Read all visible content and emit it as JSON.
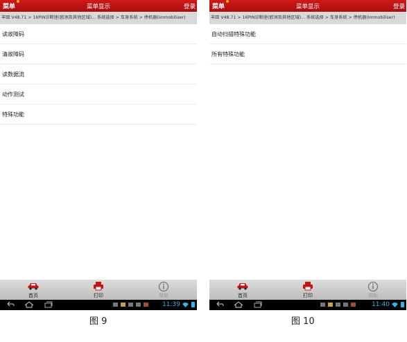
{
  "screens": [
    {
      "app_bar": {
        "menu": "菜单",
        "title": "菜单显示",
        "login": "登录"
      },
      "breadcrumb": "丰田 V48.71 > 16PIN诊断座(欧洲及其他区域)... 系统选择 > 车身系统 > 停机器(Immobiliser)",
      "items": [
        "读故障码",
        "清故障码",
        "读数据流",
        "动作测试",
        "特殊功能"
      ],
      "bottom_bar": {
        "home": "首页",
        "print": "打印",
        "help": "帮助"
      },
      "status": {
        "time": "11:39"
      }
    },
    {
      "app_bar": {
        "menu": "菜单",
        "title": "菜单显示",
        "login": "登录"
      },
      "breadcrumb": "丰田 V48.71 > 16PIN诊断座(欧洲及其他区域)... 系统选择 > 车身系统 > 停机器(Immobiliser)",
      "items": [
        "自动扫描特殊功能",
        "所有特殊功能"
      ],
      "bottom_bar": {
        "home": "首页",
        "print": "打印",
        "help": "帮助"
      },
      "status": {
        "time": "11:40"
      }
    }
  ],
  "captions": [
    "图 9",
    "图 10"
  ],
  "colors": {
    "app_bar": "#c41414",
    "accent_blue": "#33b5e5",
    "breadcrumb_bg": "#d9d9d9"
  },
  "icons": {
    "home": "car-icon",
    "print": "printer-icon",
    "help": "info-icon"
  }
}
